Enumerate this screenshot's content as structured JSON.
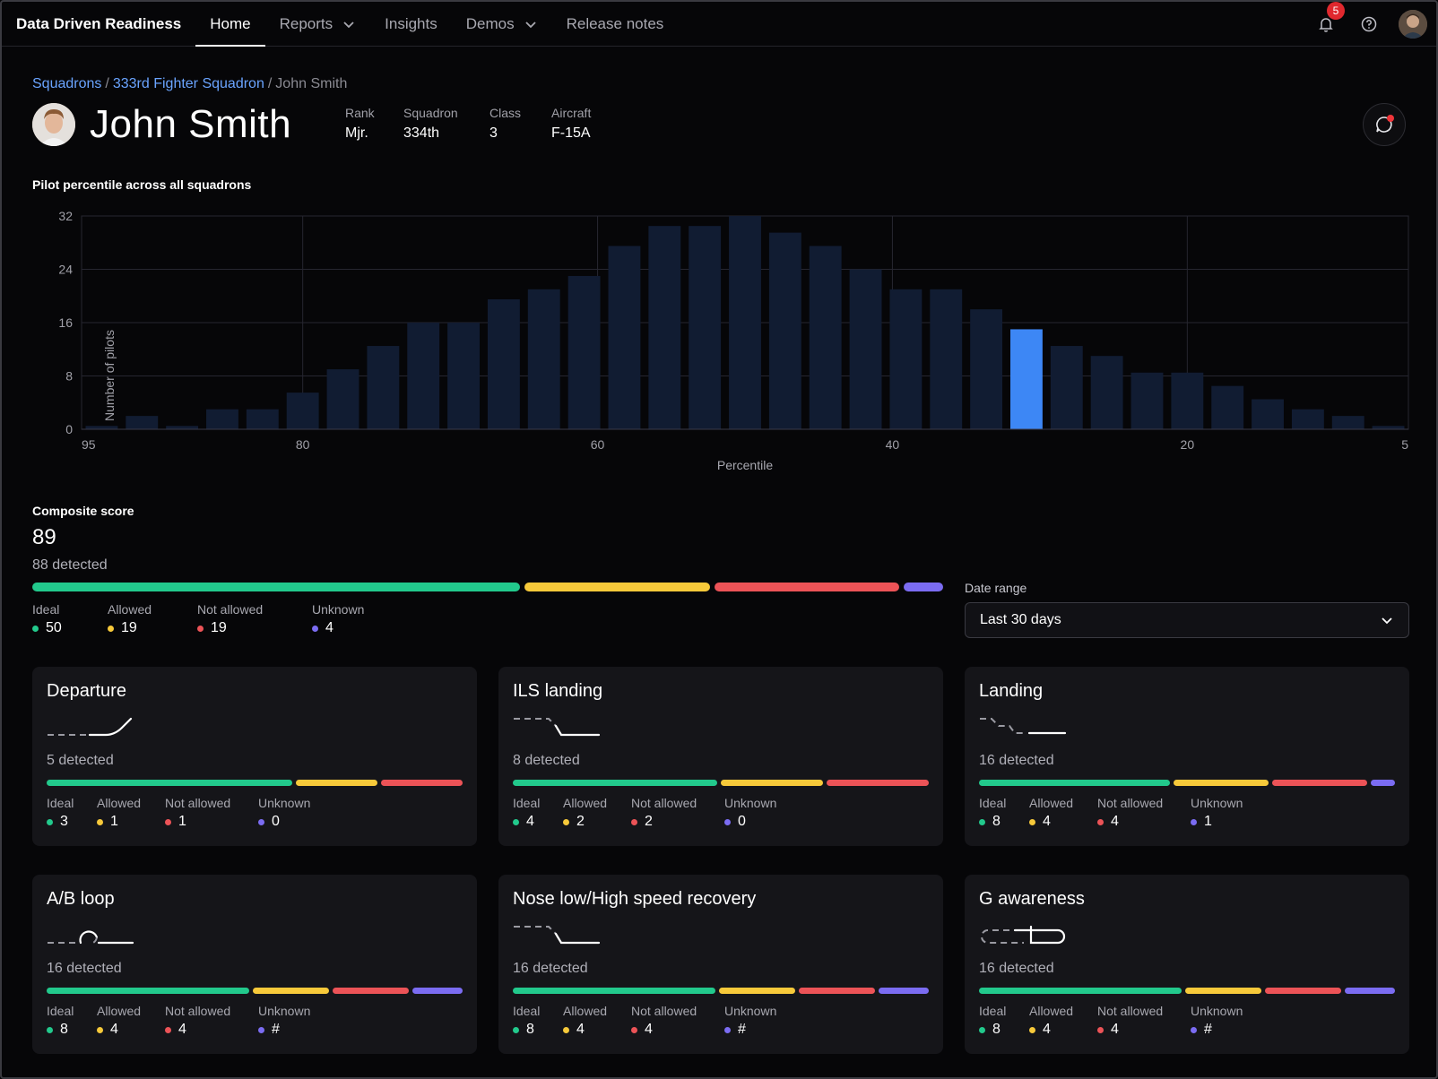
{
  "nav": {
    "brand": "Data Driven Readiness",
    "tabs": [
      {
        "label": "Home",
        "active": true,
        "dropdown": false
      },
      {
        "label": "Reports",
        "active": false,
        "dropdown": true
      },
      {
        "label": "Insights",
        "active": false,
        "dropdown": false
      },
      {
        "label": "Demos",
        "active": false,
        "dropdown": true
      },
      {
        "label": "Release notes",
        "active": false,
        "dropdown": false
      }
    ],
    "notifications": "5",
    "icons": [
      "bell-icon",
      "help-icon",
      "user-avatar"
    ]
  },
  "breadcrumb": {
    "items": [
      "Squadrons",
      "333rd Fighter Squadron",
      "John Smith"
    ],
    "separator": "/"
  },
  "pilot": {
    "name": "John Smith",
    "meta": [
      {
        "label": "Rank",
        "value": "Mjr."
      },
      {
        "label": "Squadron",
        "value": "334th"
      },
      {
        "label": "Class",
        "value": "3"
      },
      {
        "label": "Aircraft",
        "value": "F-15A"
      }
    ]
  },
  "chart_data": {
    "type": "bar",
    "title": "Pilot percentile across all squadrons",
    "xlabel": "Percentile",
    "ylabel": "Number of pilots",
    "x_ticks": [
      "95",
      "80",
      "60",
      "40",
      "20",
      "5"
    ],
    "y_ticks": [
      0,
      8,
      16,
      24,
      32
    ],
    "ylim": [
      0,
      32
    ],
    "values": [
      0.5,
      2,
      0.5,
      3,
      3,
      5.5,
      9,
      12.5,
      16,
      16,
      19.5,
      21,
      23,
      27.5,
      30.5,
      30.5,
      32,
      29.5,
      27.5,
      24,
      21,
      21,
      18,
      15,
      12.5,
      11,
      8.5,
      8.5,
      6.5,
      4.5,
      3,
      2,
      0.5
    ],
    "highlight_index": 23,
    "bar_color": "#111c32",
    "highlight_color": "#3d87f5",
    "grid": true
  },
  "composite": {
    "title": "Composite score",
    "score": "89",
    "detected": "88 detected",
    "counts": {
      "ideal": 50,
      "allowed": 19,
      "not_allowed": 19,
      "unknown": 4
    },
    "legend": [
      {
        "label": "Ideal",
        "value": "50",
        "color": "#22c98c"
      },
      {
        "label": "Allowed",
        "value": "19",
        "color": "#f7c93a"
      },
      {
        "label": "Not allowed",
        "value": "19",
        "color": "#ec5357"
      },
      {
        "label": "Unknown",
        "value": "4",
        "color": "#7b6cf2"
      }
    ]
  },
  "date_range": {
    "label": "Date range",
    "value": "Last 30 days"
  },
  "colors": {
    "ideal": "#22c98c",
    "allowed": "#f7c93a",
    "not_allowed": "#ec5357",
    "unknown": "#7b6cf2",
    "link": "#6aa4ff"
  },
  "cards": [
    {
      "title": "Departure",
      "glyph": "departure-icon",
      "detected": "5 detected",
      "bar": [
        3,
        1,
        1,
        0
      ],
      "legend": [
        {
          "label": "Ideal",
          "value": "3"
        },
        {
          "label": "Allowed",
          "value": "1"
        },
        {
          "label": "Not allowed",
          "value": "1"
        },
        {
          "label": "Unknown",
          "value": "0"
        }
      ]
    },
    {
      "title": "ILS landing",
      "glyph": "ils-landing-icon",
      "detected": "8 detected",
      "bar": [
        4,
        2,
        2,
        0
      ],
      "legend": [
        {
          "label": "Ideal",
          "value": "4"
        },
        {
          "label": "Allowed",
          "value": "2"
        },
        {
          "label": "Not allowed",
          "value": "2"
        },
        {
          "label": "Unknown",
          "value": "0"
        }
      ]
    },
    {
      "title": "Landing",
      "glyph": "landing-icon",
      "detected": "16 detected",
      "bar": [
        8,
        4,
        4,
        1
      ],
      "legend": [
        {
          "label": "Ideal",
          "value": "8"
        },
        {
          "label": "Allowed",
          "value": "4"
        },
        {
          "label": "Not allowed",
          "value": "4"
        },
        {
          "label": "Unknown",
          "value": "1"
        }
      ]
    },
    {
      "title": "A/B loop",
      "glyph": "ab-loop-icon",
      "detected": "16 detected",
      "bar": [
        8,
        3,
        3,
        2
      ],
      "legend": [
        {
          "label": "Ideal",
          "value": "8"
        },
        {
          "label": "Allowed",
          "value": "4"
        },
        {
          "label": "Not allowed",
          "value": "4"
        },
        {
          "label": "Unknown",
          "value": "#"
        }
      ]
    },
    {
      "title": "Nose low/High speed recovery",
      "glyph": "nose-low-recovery-icon",
      "detected": "16 detected",
      "bar": [
        8,
        3,
        3,
        2
      ],
      "legend": [
        {
          "label": "Ideal",
          "value": "8"
        },
        {
          "label": "Allowed",
          "value": "4"
        },
        {
          "label": "Not allowed",
          "value": "4"
        },
        {
          "label": "Unknown",
          "value": "#"
        }
      ]
    },
    {
      "title": "G awareness",
      "glyph": "g-awareness-icon",
      "detected": "16 detected",
      "bar": [
        8,
        3,
        3,
        2
      ],
      "legend": [
        {
          "label": "Ideal",
          "value": "8"
        },
        {
          "label": "Allowed",
          "value": "4"
        },
        {
          "label": "Not allowed",
          "value": "4"
        },
        {
          "label": "Unknown",
          "value": "#"
        }
      ]
    }
  ]
}
